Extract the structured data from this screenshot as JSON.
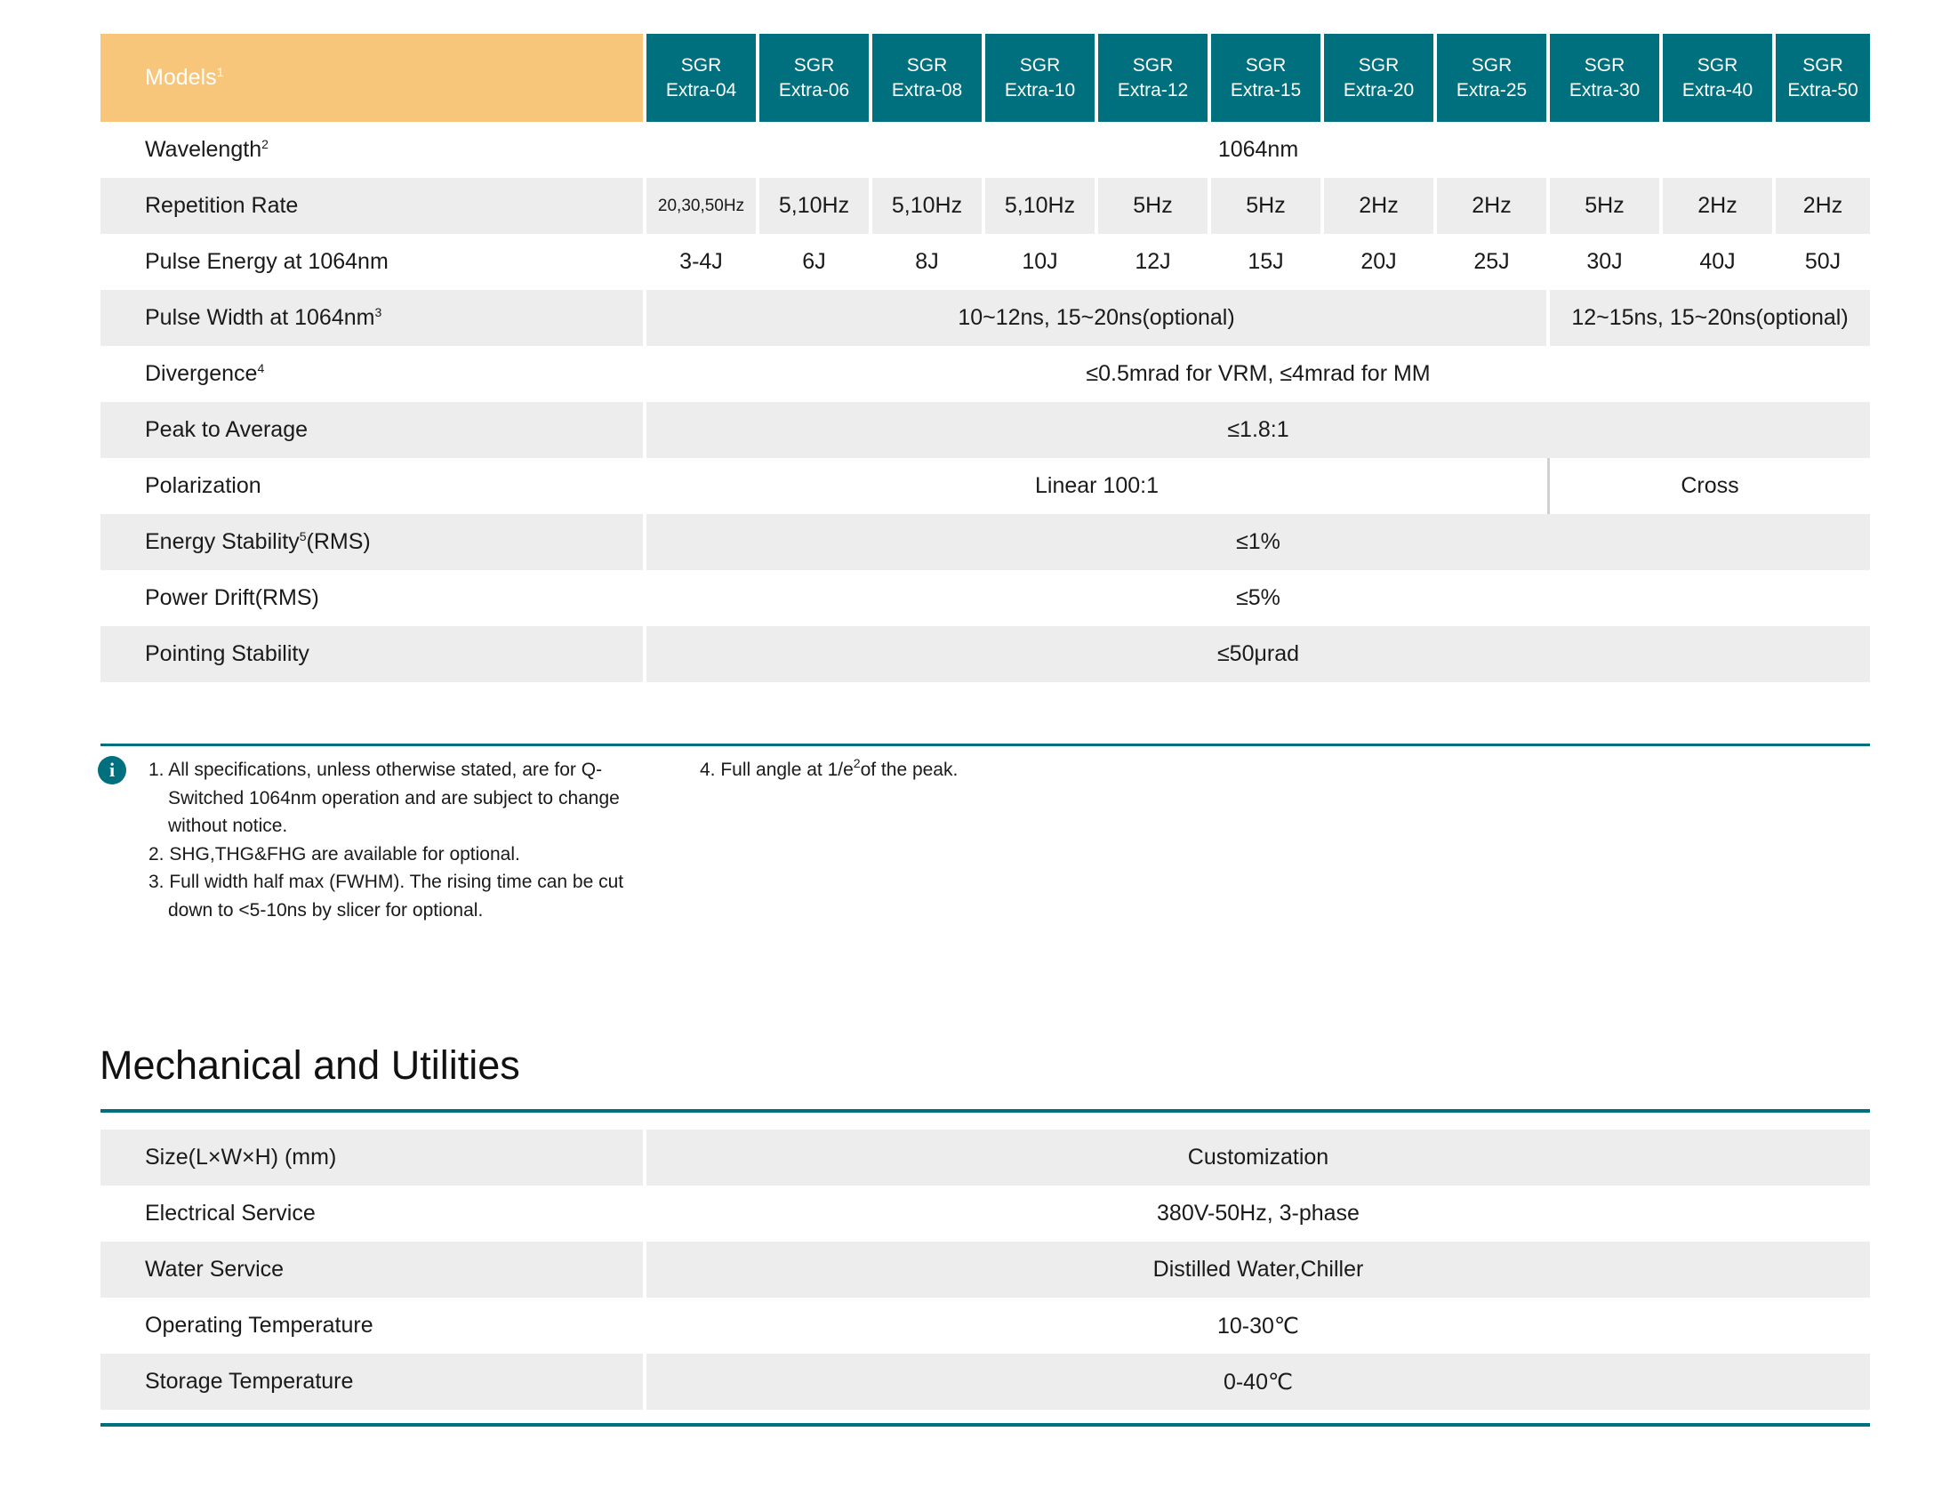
{
  "spec_table": {
    "models_label": "Models",
    "models_note": "1",
    "models": [
      {
        "line1": "SGR",
        "line2": "Extra-04"
      },
      {
        "line1": "SGR",
        "line2": "Extra-06"
      },
      {
        "line1": "SGR",
        "line2": "Extra-08"
      },
      {
        "line1": "SGR",
        "line2": "Extra-10"
      },
      {
        "line1": "SGR",
        "line2": "Extra-12"
      },
      {
        "line1": "SGR",
        "line2": "Extra-15"
      },
      {
        "line1": "SGR",
        "line2": "Extra-20"
      },
      {
        "line1": "SGR",
        "line2": "Extra-25"
      },
      {
        "line1": "SGR",
        "line2": "Extra-30"
      },
      {
        "line1": "SGR",
        "line2": "Extra-40"
      },
      {
        "line1": "SGR",
        "line2": "Extra-50"
      }
    ],
    "wavelength": {
      "label": "Wavelength",
      "note": "2",
      "value": "1064nm"
    },
    "repetition_rate": {
      "label": "Repetition Rate",
      "values": [
        "20,30,50Hz",
        "5,10Hz",
        "5,10Hz",
        "5,10Hz",
        "5Hz",
        "5Hz",
        "2Hz",
        "2Hz",
        "5Hz",
        "2Hz",
        "2Hz"
      ]
    },
    "pulse_energy": {
      "label": "Pulse Energy at 1064nm",
      "values": [
        "3-4J",
        "6J",
        "8J",
        "10J",
        "12J",
        "15J",
        "20J",
        "25J",
        "30J",
        "40J",
        "50J"
      ]
    },
    "pulse_width": {
      "label": "Pulse Width at 1064nm",
      "note": "3",
      "value_a": "10~12ns,  15~20ns(optional)",
      "value_b": "12~15ns,  15~20ns(optional)"
    },
    "divergence": {
      "label": "Divergence",
      "note": "4",
      "value": "≤0.5mrad for VRM, ≤4mrad for MM"
    },
    "peak_to_average": {
      "label": "Peak to Average",
      "value": "≤1.8:1"
    },
    "polarization": {
      "label": "Polarization",
      "value_a": "Linear 100:1",
      "value_b": "Cross"
    },
    "energy_stability": {
      "label_a": "Energy Stability",
      "note": "5",
      "label_b": "(RMS)",
      "value": "≤1%"
    },
    "power_drift": {
      "label": "Power Drift(RMS)",
      "value": "≤5%"
    },
    "pointing_stability": {
      "label": "Pointing Stability",
      "value": "≤50μrad"
    }
  },
  "notes": {
    "icon": "info-icon",
    "left": [
      "1. All specifications, unless otherwise stated, are for Q-Switched 1064nm operation and are subject to change without notice.",
      "2. SHG,THG&FHG are available for optional.",
      "3. Full width half max (FWHM). The rising time can be cut down to <5-10ns by slicer for optional."
    ],
    "right_a": "4. Full angle at 1/e",
    "right_sup": "2",
    "right_b": "of the peak."
  },
  "mechanical": {
    "title": "Mechanical and Utilities",
    "rows": [
      {
        "label": "Size(L×W×H) (mm)",
        "value": "Customization"
      },
      {
        "label": "Electrical Service",
        "value": "380V-50Hz, 3-phase"
      },
      {
        "label": "Water Service",
        "value": "Distilled Water,Chiller"
      },
      {
        "label": "Operating Temperature",
        "value": "10-30℃"
      },
      {
        "label": "Storage Temperature",
        "value": "0-40℃"
      }
    ]
  },
  "colors": {
    "teal": "#00707e",
    "header_orange": "#f7c67b",
    "row_gray": "#ededed"
  }
}
